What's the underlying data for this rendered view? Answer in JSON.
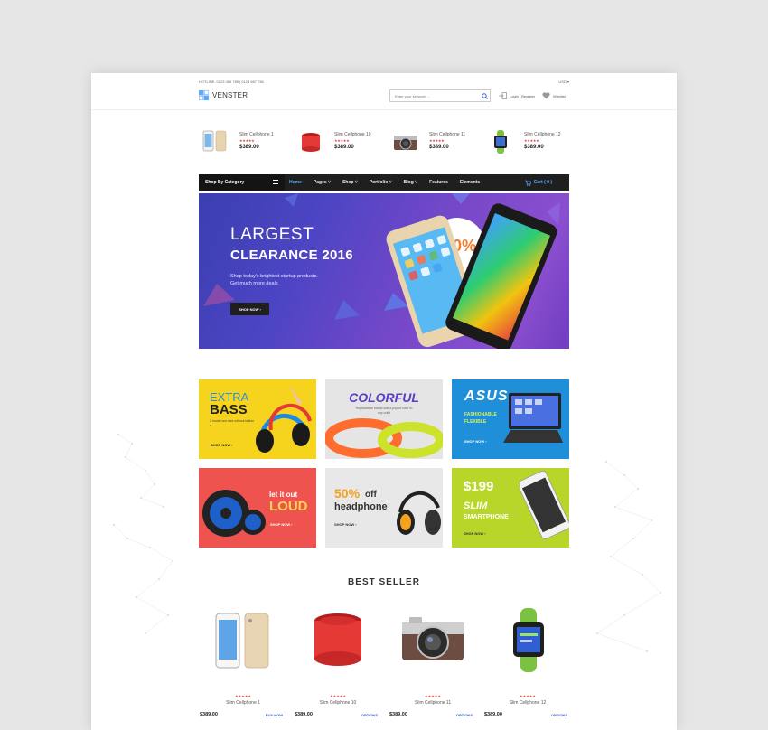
{
  "topbar": {
    "hotline": "HOTLINE: 0123 456 789 | 0123 987 736",
    "currency": "USD ▾"
  },
  "brand": {
    "name": "VENSTER"
  },
  "search": {
    "placeholder": "Enter your keyword ...",
    "icon": "search-icon"
  },
  "account": {
    "label": "Login / Register",
    "icon": "login-icon"
  },
  "wishlist": {
    "label": "Wishlist",
    "icon": "heart-icon"
  },
  "mini_products": [
    {
      "name": "Slim Cellphone 1",
      "stars": "★★★★★",
      "price": "$389.00",
      "icon": "smartphone-icon"
    },
    {
      "name": "Slim Cellphone 10",
      "stars": "★★★★★",
      "price": "$389.00",
      "icon": "speaker-icon"
    },
    {
      "name": "Slim Cellphone 11",
      "stars": "★★★★★",
      "price": "$389.00",
      "icon": "camera-icon"
    },
    {
      "name": "Slim Cellphone 12",
      "stars": "★★★★★",
      "price": "$389.00",
      "icon": "smartwatch-icon"
    }
  ],
  "nav": {
    "category": "Shop By Category",
    "items": [
      "Home",
      "Pages ˅",
      "Shop ˅",
      "Portfolio ˅",
      "Blog ˅",
      "Features",
      "Elements"
    ],
    "cart": "Cart ( 0 )"
  },
  "hero": {
    "title1": "LARGEST",
    "title2": "CLEARANCE 2016",
    "subtitle1": "Shop today's brightest startup products.",
    "subtitle2": "Get much more deals",
    "button": "SHOP NOW ›",
    "badge": "-30%"
  },
  "promos": [
    {
      "title1": "EXTRA",
      "title2": "BASS",
      "text": "2 model one size without button s",
      "shop": "SHOP NOW ›",
      "bg": "#f6d31c"
    },
    {
      "title1": "COLORFUL",
      "text": "Replaceable bands add a pop of color to any outfit",
      "bg": "#e5e5e5"
    },
    {
      "title1": "ASUS",
      "title2": "FASHIONABLE",
      "title3": "FLEXIBLE",
      "shop": "SHOP NOW ›",
      "bg": "#1e8fd8"
    },
    {
      "title1": "let it out",
      "title2": "LOUD",
      "shop": "SHOP NOW ›",
      "bg": "#ef5350"
    },
    {
      "title1": "50%",
      "title2": "off",
      "title3": "headphone",
      "shop": "SHOP NOW ›",
      "bg": "#e8e8e8"
    },
    {
      "title1": "$199",
      "title2": "SLIM",
      "title3": "SMARTPHONE",
      "shop": "SHOP NOW ›",
      "bg": "#b8d62a"
    }
  ],
  "best_seller": {
    "title": "BEST SELLER",
    "items": [
      {
        "name": "Slim Cellphone 1",
        "stars": "★★★★★",
        "price": "$389.00",
        "action": "BUY NOW",
        "icon": "smartphone-icon"
      },
      {
        "name": "Slim Cellphone 10",
        "stars": "★★★★★",
        "price": "$389.00",
        "action": "OPTIONS",
        "icon": "speaker-icon"
      },
      {
        "name": "Slim Cellphone 11",
        "stars": "★★★★★",
        "price": "$389.00",
        "action": "OPTIONS",
        "icon": "camera-icon"
      },
      {
        "name": "Slim Cellphone 12",
        "stars": "★★★★★",
        "price": "$389.00",
        "action": "OPTIONS",
        "icon": "smartwatch-icon"
      }
    ]
  },
  "colors": {
    "accent": "#5aa9ff",
    "nav_bg": "#1f1f1f",
    "star": "#e53935",
    "link": "#3a5ec9"
  }
}
